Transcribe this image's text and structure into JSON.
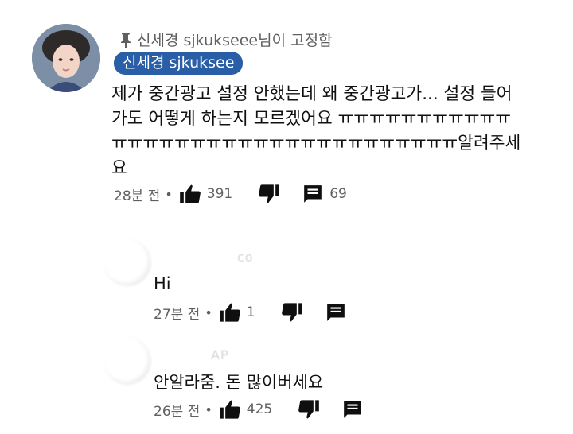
{
  "pinned_comment": {
    "pinned_label": "신세경 sjkukseee님이 고정함",
    "author": "신세경 sjkuksee",
    "text": "제가 중간광고 설정 안했는데 왜 중간광고가... 설정 들어가도 어떻게 하는지 모르겠어요 ㅠㅠㅠㅠㅠㅠㅠㅠㅠㅠㅠㅠㅠㅠㅠㅠㅠㅠㅠㅠㅠㅠㅠㅠㅠㅠㅠㅠㅠㅠㅠㅠㅠ알려주세요",
    "time": "28분 전",
    "likes": "391",
    "replies": "69"
  },
  "replies": [
    {
      "author_faded": "co",
      "text": "Hi",
      "time": "27분 전",
      "likes": "1"
    },
    {
      "author_faded": "AP",
      "text": "안알라줌. 돈 많이버세요",
      "time": "26분 전",
      "likes": "425"
    }
  ],
  "icons": {
    "pin": "pin-icon",
    "like": "thumb-up-icon",
    "dislike": "thumb-down-icon",
    "reply": "comment-icon"
  },
  "colors": {
    "author_badge": "#2a5fa8",
    "meta_text": "#606060",
    "icon": "#0f0f0f"
  }
}
